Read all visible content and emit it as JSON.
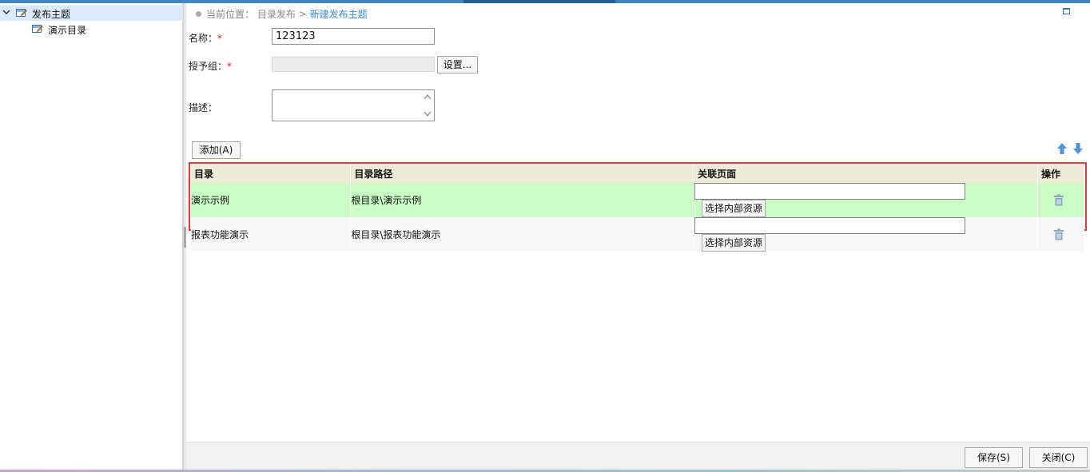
{
  "tree": {
    "root": {
      "label": "发布主题",
      "icon": "edit-folder-icon"
    },
    "child": {
      "label": "演示目录",
      "icon": "edit-folder-icon"
    }
  },
  "breadcrumb": {
    "prefix": "当前位置：",
    "level1": "目录发布",
    "separator": ">",
    "current": "新建发布主题"
  },
  "form": {
    "name_label": "名称：",
    "name_required": "*",
    "name_value": "123123",
    "group_label": "授予组：",
    "group_required": "*",
    "group_value": "",
    "settings_button": "设置...",
    "desc_label": "描述：",
    "desc_value": ""
  },
  "toolbar": {
    "add_button": "添加(A)",
    "move_up_icon": "arrow-up-icon",
    "move_down_icon": "arrow-down-icon"
  },
  "grid": {
    "columns": [
      "目录",
      "目录路径",
      "关联页面",
      "操作"
    ],
    "rows": [
      {
        "directory": "演示示例",
        "path": "根目录\\演示示例",
        "page": "",
        "select_button": "选择内部资源",
        "action_icon": "trash-icon"
      },
      {
        "directory": "报表功能演示",
        "path": "根目录\\报表功能演示",
        "page": "",
        "select_button": "选择内部资源",
        "action_icon": "trash-icon"
      }
    ]
  },
  "footer": {
    "save_button": "保存(S)",
    "close_button": "关闭(C)"
  },
  "colors": {
    "accent": "#3b8ed6",
    "highlight_row": "#c8fdc4",
    "frame": "#e23b3b",
    "header_bg": "#ecebd6"
  }
}
